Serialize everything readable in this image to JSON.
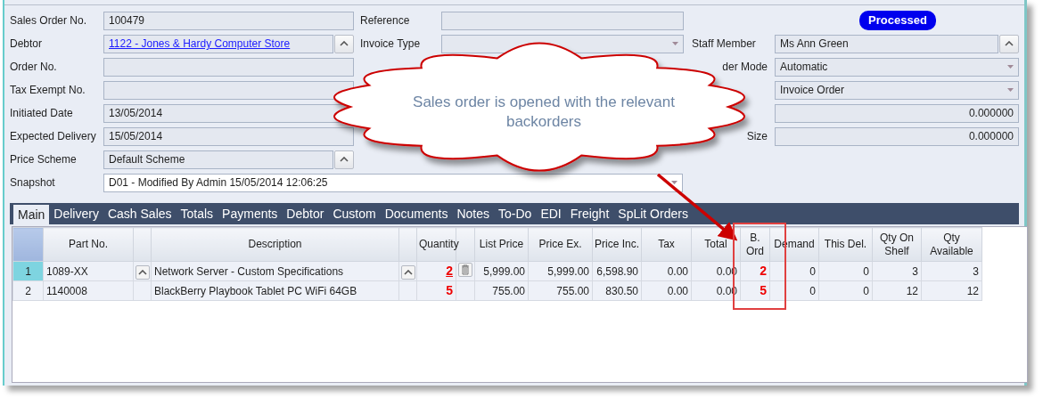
{
  "status_badge": "Processed",
  "left_fields": [
    {
      "label": "Sales Order No.",
      "kind": "text",
      "value": "100479",
      "lookup": false
    },
    {
      "label": "Debtor",
      "kind": "link",
      "value": "1122 - Jones & Hardy Computer Store",
      "lookup": true
    },
    {
      "label": "Order No.",
      "kind": "text",
      "lookup": false
    },
    {
      "label": "Tax Exempt No.",
      "kind": "text",
      "lookup": false
    },
    {
      "label": "Initiated Date",
      "kind": "text",
      "value": "13/05/2014",
      "lookup": false
    },
    {
      "label": "Expected Delivery",
      "kind": "text",
      "value": "15/05/2014",
      "lookup": false
    },
    {
      "label": "Price Scheme",
      "kind": "text",
      "value": "Default Scheme",
      "lookup": true
    }
  ],
  "middle_fields": [
    {
      "label": "Reference",
      "kind": "text",
      "lookup": false
    },
    {
      "label": "Invoice Type",
      "kind": "combo",
      "lookup": false
    }
  ],
  "right_fields": [
    {
      "label": "Staff Member",
      "kind": "text",
      "value": "Ms Ann Green",
      "lookup": true
    },
    {
      "label": "der Mode",
      "kind": "combo",
      "value": "Automatic",
      "lookup": false
    },
    {
      "kind": "combo",
      "value": "Invoice Order",
      "lookup": false
    },
    {
      "kind": "number",
      "value": "0.000000",
      "lookup": false
    },
    {
      "label": "Size",
      "kind": "number",
      "value": "0.000000",
      "lookup": false
    }
  ],
  "snapshot": {
    "label": "Snapshot",
    "kind": "combo",
    "value": "D01 - Modified By Admin 15/05/2014 12:06:25"
  },
  "tabs": [
    {
      "label": "Main",
      "selected": true
    },
    {
      "label": "Delivery",
      "selected": false
    },
    {
      "label": "Cash Sales",
      "selected": false
    },
    {
      "label": "Totals",
      "selected": false
    },
    {
      "label": "Payments",
      "selected": false
    },
    {
      "label": "Debtor",
      "selected": false
    },
    {
      "label": "Custom",
      "selected": false
    },
    {
      "label": "Documents",
      "selected": false
    },
    {
      "label": "Notes",
      "selected": false
    },
    {
      "label": "To-Do",
      "selected": false
    },
    {
      "label": "EDI",
      "selected": false
    },
    {
      "label": "Freight",
      "selected": false
    },
    {
      "label": "SpLit Orders",
      "selected": false
    }
  ],
  "table": {
    "columns": [
      "Part No.",
      "",
      "Description",
      "",
      "Quantity",
      "",
      "List Price",
      "Price Ex.",
      "Price Inc.",
      "Tax",
      "Total",
      "B. Ord",
      "Demand",
      "This Del.",
      "Qty On Shelf",
      "Qty Available"
    ],
    "rows": [
      {
        "number": "1",
        "selected": true,
        "part_no": "1089-XX",
        "description": "Network Server - Custom Specifications",
        "quantity": "2",
        "list_price": "5,999.00",
        "price_ex": "5,999.00",
        "price_inc": "6,598.90",
        "tax": "0.00",
        "total": "0.00",
        "b_ord": "2",
        "demand": "0",
        "this_del": "0",
        "qty_on_shelf": "3",
        "qty_available": "3"
      },
      {
        "number": "2",
        "selected": false,
        "part_no": "1140008",
        "description": "BlackBerry Playbook Tablet PC WiFi 64GB",
        "quantity": "5",
        "list_price": "755.00",
        "price_ex": "755.00",
        "price_inc": "830.50",
        "tax": "0.00",
        "total": "0.00",
        "b_ord": "5",
        "demand": "0",
        "this_del": "0",
        "qty_on_shelf": "12",
        "qty_available": "12"
      }
    ]
  },
  "callout": {
    "text": "Sales order is opened with the relevant backorders"
  }
}
